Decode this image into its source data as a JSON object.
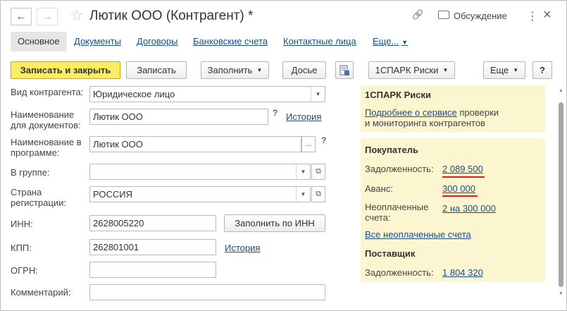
{
  "window": {
    "title": "Лютик ООО (Контрагент) *",
    "back_icon": "←",
    "forward_icon": "→",
    "star_icon": "☆",
    "link_icon": "🔗",
    "discussion_label": "Обсуждение",
    "menu_icon": "⋮",
    "close_icon": "×"
  },
  "tabs": [
    {
      "label": "Основное"
    },
    {
      "label": "Документы"
    },
    {
      "label": "Договоры"
    },
    {
      "label": "Банковские счета"
    },
    {
      "label": "Контактные лица"
    },
    {
      "label": "Еще..."
    }
  ],
  "toolbar": {
    "save_close": "Записать и закрыть",
    "save": "Записать",
    "fill": "Заполнить",
    "dossier": "Досье",
    "spark": "1СПАРК Риски",
    "more": "Еще",
    "help": "?"
  },
  "form": {
    "kind_label": "Вид контрагента:",
    "kind_value": "Юридическое лицо",
    "docname_label": "Наименование для документов:",
    "docname_value": "Лютик ООО",
    "progname_label": "Наименование в программе:",
    "progname_value": "Лютик ООО",
    "group_label": "В группе:",
    "group_value": "",
    "country_label": "Страна регистрации:",
    "country_value": "РОССИЯ",
    "inn_label": "ИНН:",
    "inn_value": "2628005220",
    "fill_by_inn": "Заполнить по ИНН",
    "kpp_label": "КПП:",
    "kpp_value": "262801001",
    "ogrn_label": "ОГРН:",
    "ogrn_value": "",
    "comment_label": "Комментарий:",
    "comment_value": "",
    "history_link": "История",
    "help_mark": "?",
    "ellipsis": "...",
    "open_icon": "⧉"
  },
  "spark_panel": {
    "title": "1СПАРК Риски",
    "link": "Подробнее о сервисе",
    "text1": " проверки",
    "text2": "и мониторинга контрагентов"
  },
  "buyer_panel": {
    "title": "Покупатель",
    "debt_label": "Задолженность:",
    "debt_value": "2 089 500",
    "advance_label": "Аванс:",
    "advance_value": "300 000",
    "unpaid_label": "Неоплаченные счета:",
    "unpaid_value": "2 на 300 000",
    "all_unpaid": "Все неоплаченные счета",
    "supplier_title": "Поставщик",
    "supplier_debt_label": "Задолженность:",
    "supplier_debt_value": "1 804 320"
  },
  "colors": {
    "primary_button": "#fbed63",
    "panel_bg": "#fcf6d0",
    "link": "#1b4c8a",
    "underline_red": "#e21b1b"
  }
}
